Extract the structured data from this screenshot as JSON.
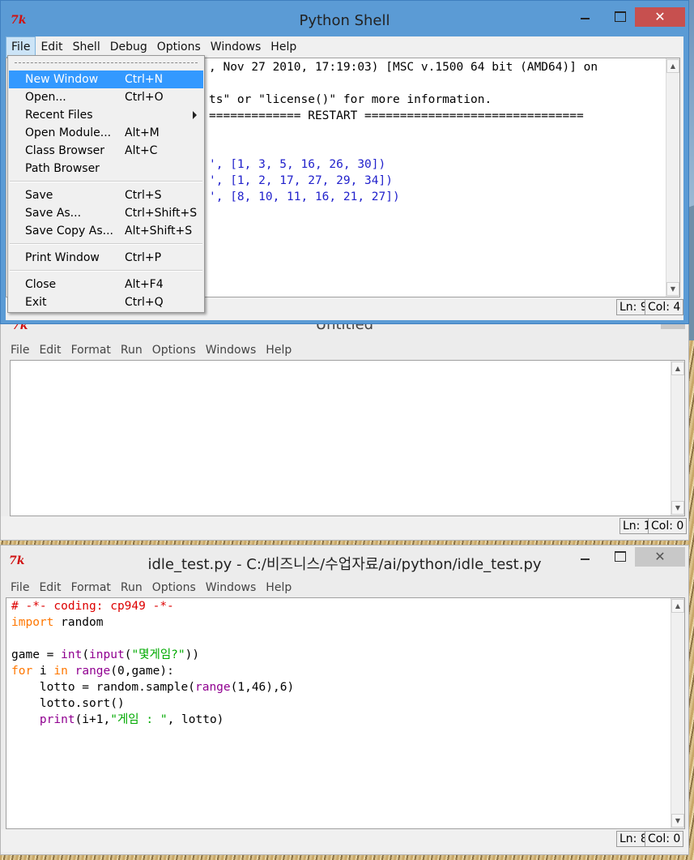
{
  "shell": {
    "title": "Python Shell",
    "menu": [
      "File",
      "Edit",
      "Shell",
      "Debug",
      "Options",
      "Windows",
      "Help"
    ],
    "lines": [
      ", Nov 27 2010, 17:19:03) [MSC v.1500 64 bit (AMD64)] on",
      "ts\" or \"license()\" for more information.",
      "============= RESTART ===============================",
      "', [1, 3, 5, 16, 26, 30])",
      "', [1, 2, 17, 27, 29, 34])",
      "', [8, 10, 11, 16, 21, 27])"
    ],
    "status_ln": "Ln: 9",
    "status_col": "Col: 4"
  },
  "file_menu": {
    "items": [
      {
        "label": "New Window",
        "accel": "Ctrl+N"
      },
      {
        "label": "Open...",
        "accel": "Ctrl+O"
      },
      {
        "label": "Recent Files",
        "accel": ""
      },
      {
        "label": "Open Module...",
        "accel": "Alt+M"
      },
      {
        "label": "Class Browser",
        "accel": "Alt+C"
      },
      {
        "label": "Path Browser",
        "accel": ""
      },
      {
        "label": "Save",
        "accel": "Ctrl+S"
      },
      {
        "label": "Save As...",
        "accel": "Ctrl+Shift+S"
      },
      {
        "label": "Save Copy As...",
        "accel": "Alt+Shift+S"
      },
      {
        "label": "Print Window",
        "accel": "Ctrl+P"
      },
      {
        "label": "Close",
        "accel": "Alt+F4"
      },
      {
        "label": "Exit",
        "accel": "Ctrl+Q"
      }
    ]
  },
  "untitled": {
    "title": "Untitled",
    "menu": [
      "File",
      "Edit",
      "Format",
      "Run",
      "Options",
      "Windows",
      "Help"
    ],
    "status_ln": "Ln: 1",
    "status_col": "Col: 0"
  },
  "editor": {
    "title": "idle_test.py - C:/비즈니스/수업자료/ai/python/idle_test.py",
    "menu": [
      "File",
      "Edit",
      "Format",
      "Run",
      "Options",
      "Windows",
      "Help"
    ],
    "code": {
      "l1": "# -*- coding: cp949 -*-",
      "l2_kw": "import",
      "l2_rest": " random",
      "l4_a": "game = ",
      "l4_int": "int",
      "l4_b": "(",
      "l4_input": "input",
      "l4_c": "(",
      "l4_str": "\"몇게임?\"",
      "l4_d": "))",
      "l5_for": "for",
      "l5_a": " i ",
      "l5_in": "in",
      "l5_b": " ",
      "l5_range": "range",
      "l5_c": "(0,game):",
      "l6_a": "    lotto = random.sample(",
      "l6_range": "range",
      "l6_b": "(1,46),6)",
      "l7": "    lotto.sort()",
      "l8_ind": "    ",
      "l8_print": "print",
      "l8_a": "(i+1,",
      "l8_str": "\"게임 : \"",
      "l8_b": ", lotto)"
    },
    "status_ln": "Ln: 8",
    "status_col": "Col: 0"
  },
  "colors": {
    "titlebar_active": "#5b9bd5",
    "titlebar_inactive": "#ececec",
    "close_active": "#c7504f",
    "menu_highlight": "#3399ff"
  },
  "icons": {
    "logo": "tk-feather-logo",
    "minimize": "minimize-icon",
    "maximize": "maximize-icon",
    "close": "close-icon"
  }
}
